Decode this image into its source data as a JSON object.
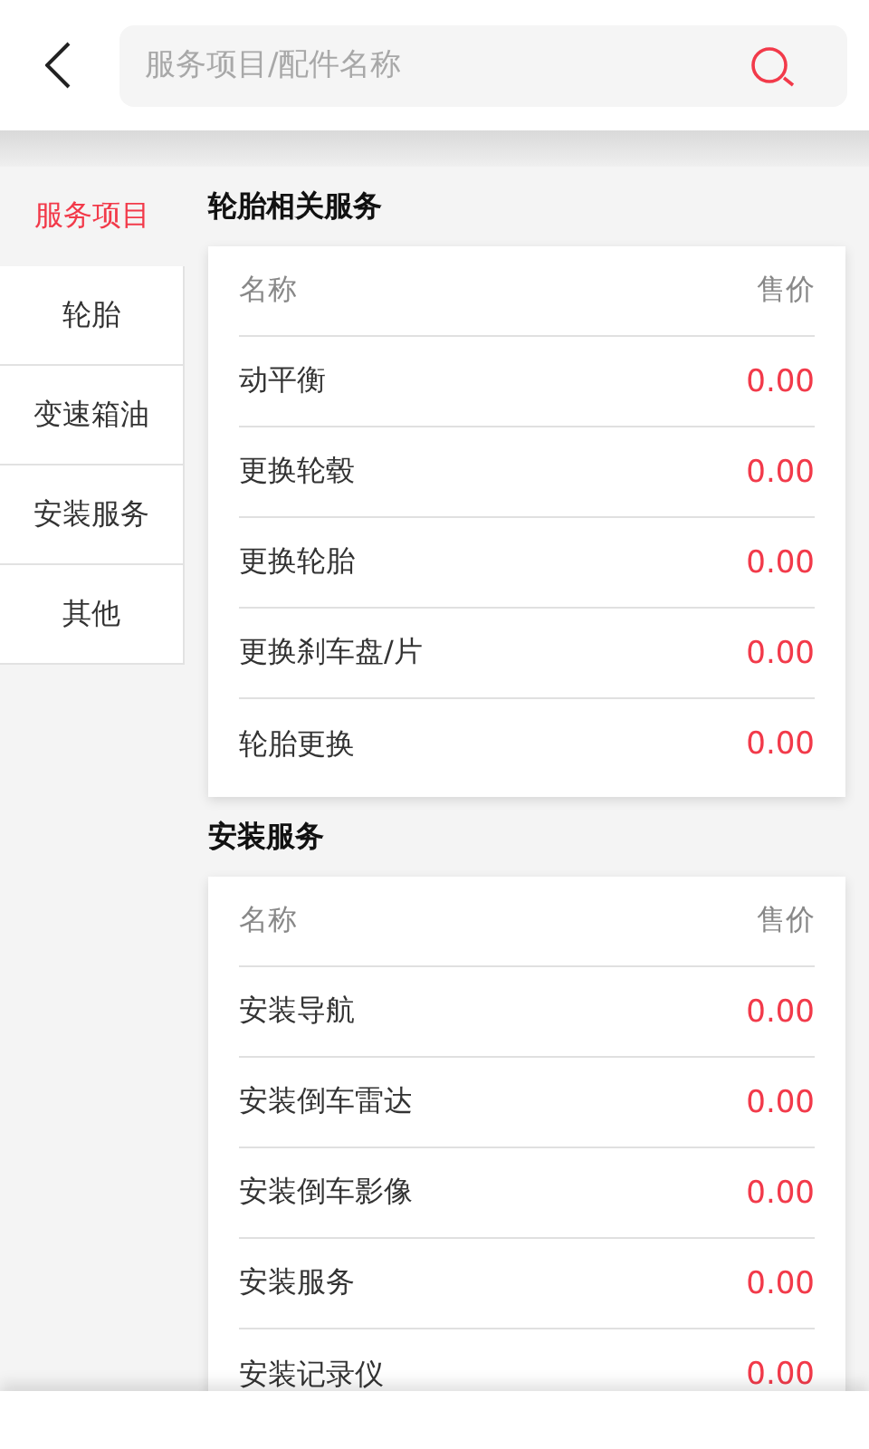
{
  "search": {
    "placeholder": "服务项目/配件名称"
  },
  "sidebar": {
    "items": [
      {
        "label": "服务项目",
        "selected": true
      },
      {
        "label": "轮胎",
        "selected": false
      },
      {
        "label": "变速箱油",
        "selected": false
      },
      {
        "label": "安装服务",
        "selected": false
      },
      {
        "label": "其他",
        "selected": false
      }
    ]
  },
  "sections": [
    {
      "title": "轮胎相关服务",
      "columns": [
        "名称",
        "售价"
      ],
      "rows": [
        {
          "name": "动平衡",
          "price": "0.00"
        },
        {
          "name": "更换轮毂",
          "price": "0.00"
        },
        {
          "name": "更换轮胎",
          "price": "0.00"
        },
        {
          "name": "更换刹车盘/片",
          "price": "0.00"
        },
        {
          "name": "轮胎更换",
          "price": "0.00"
        }
      ]
    },
    {
      "title": "安装服务",
      "columns": [
        "名称",
        "售价"
      ],
      "rows": [
        {
          "name": "安装导航",
          "price": "0.00"
        },
        {
          "name": "安装倒车雷达",
          "price": "0.00"
        },
        {
          "name": "安装倒车影像",
          "price": "0.00"
        },
        {
          "name": "安装服务",
          "price": "0.00"
        },
        {
          "name": "安装记录仪",
          "price": "0.00"
        }
      ]
    }
  ]
}
